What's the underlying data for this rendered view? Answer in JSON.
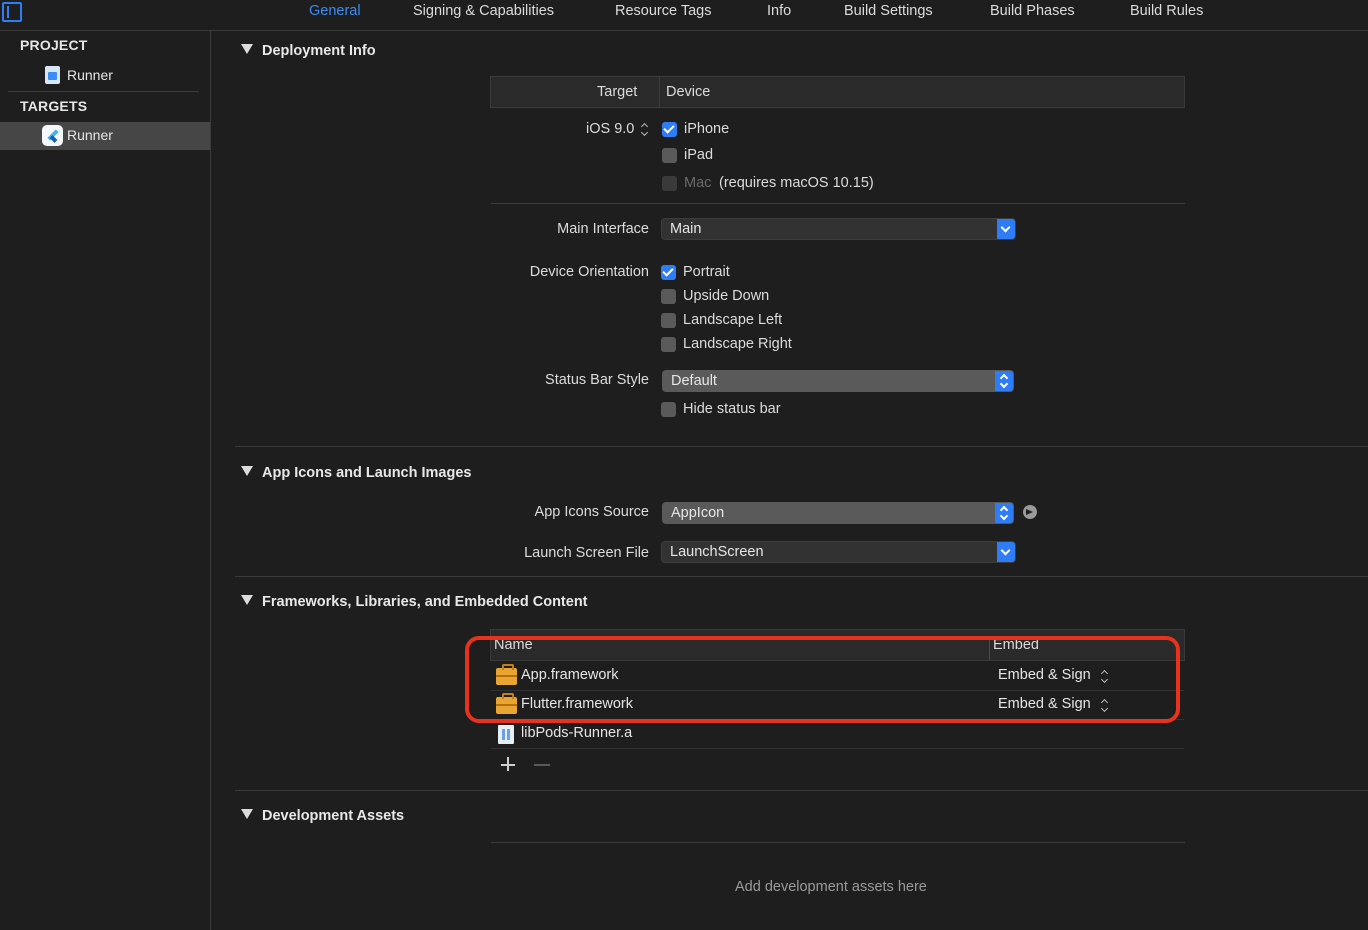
{
  "tabs": [
    {
      "label": "General",
      "active": true
    },
    {
      "label": "Signing & Capabilities"
    },
    {
      "label": "Resource Tags"
    },
    {
      "label": "Info"
    },
    {
      "label": "Build Settings"
    },
    {
      "label": "Build Phases"
    },
    {
      "label": "Build Rules"
    }
  ],
  "sidebar": {
    "project_header": "PROJECT",
    "project_item": "Runner",
    "targets_header": "TARGETS",
    "target_item": "Runner"
  },
  "deployment": {
    "title": "Deployment Info",
    "col_target": "Target",
    "col_device": "Device",
    "ios_version": "iOS 9.0",
    "devices": [
      {
        "label": "iPhone",
        "checked": true
      },
      {
        "label": "iPad",
        "checked": false
      }
    ],
    "mac_label": "Mac",
    "mac_note": "(requires macOS 10.15)",
    "main_interface_label": "Main Interface",
    "main_interface_value": "Main",
    "orientation_label": "Device Orientation",
    "orientations": [
      {
        "label": "Portrait",
        "checked": true
      },
      {
        "label": "Upside Down",
        "checked": false
      },
      {
        "label": "Landscape Left",
        "checked": false
      },
      {
        "label": "Landscape Right",
        "checked": false
      }
    ],
    "status_bar_label": "Status Bar Style",
    "status_bar_value": "Default",
    "hide_status_bar": "Hide status bar"
  },
  "app_icons": {
    "title": "App Icons and Launch Images",
    "source_label": "App Icons Source",
    "source_value": "AppIcon",
    "launch_label": "Launch Screen File",
    "launch_value": "LaunchScreen"
  },
  "frameworks": {
    "title": "Frameworks, Libraries, and Embedded Content",
    "col_name": "Name",
    "col_embed": "Embed",
    "rows": [
      {
        "name": "App.framework",
        "embed": "Embed & Sign",
        "icon": "toolbox-icon"
      },
      {
        "name": "Flutter.framework",
        "embed": "Embed & Sign",
        "icon": "toolbox-icon"
      },
      {
        "name": "libPods-Runner.a",
        "embed": "",
        "icon": "library-icon"
      }
    ]
  },
  "dev_assets": {
    "title": "Development Assets",
    "placeholder": "Add development assets here"
  },
  "colors": {
    "accent": "#2e7cf6",
    "highlight": "#e8321c"
  }
}
